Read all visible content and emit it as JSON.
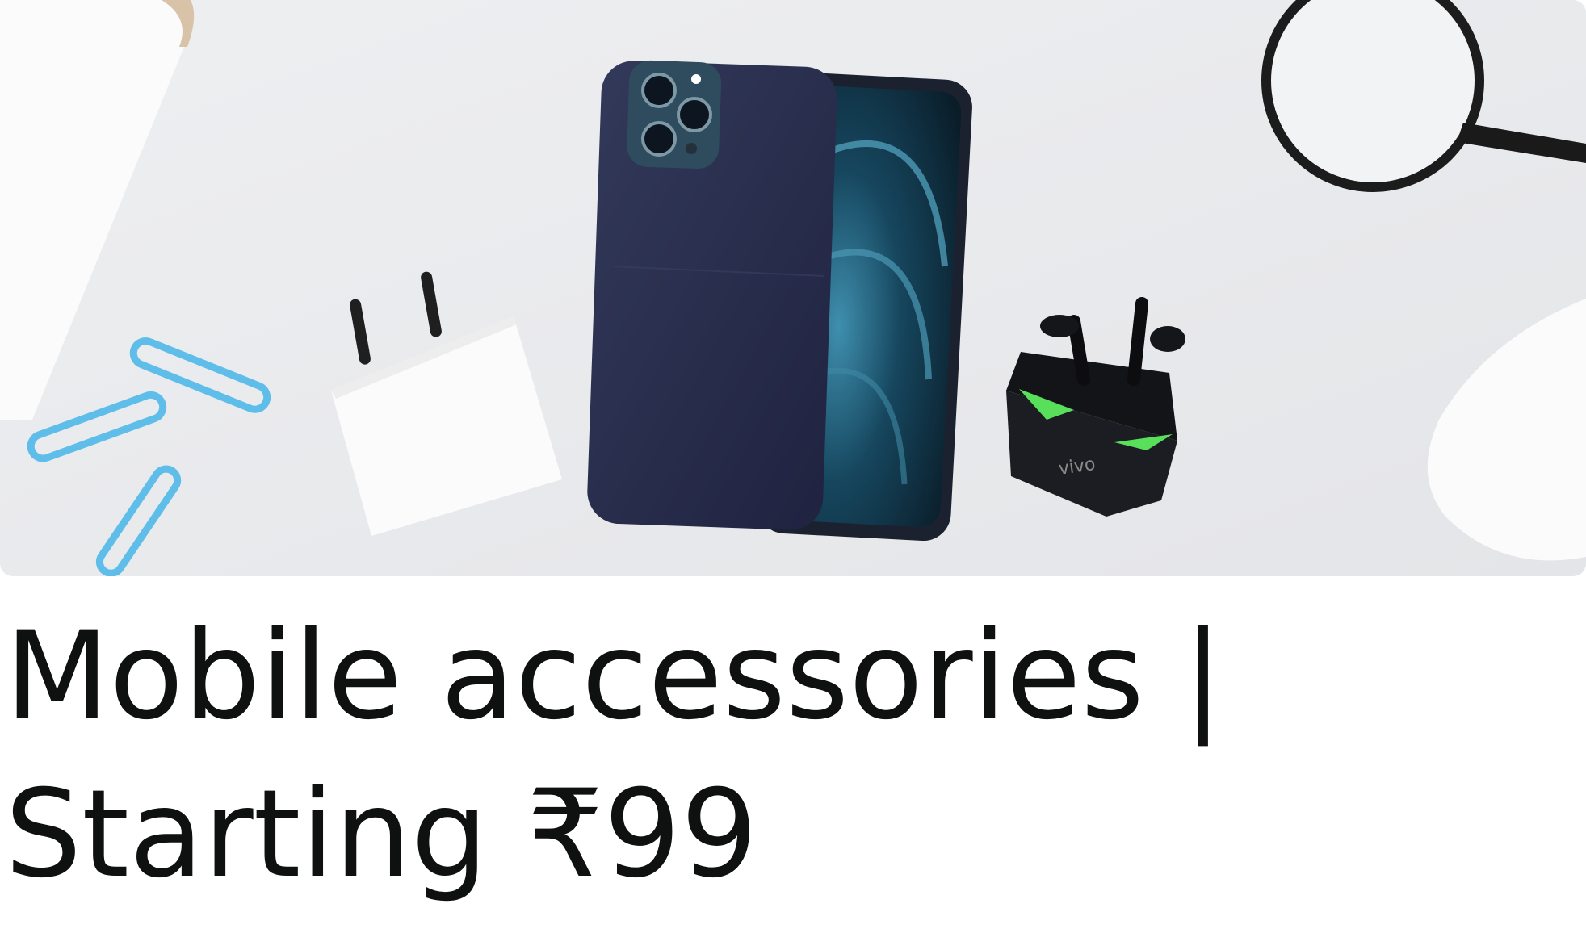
{
  "card": {
    "title_line1": "Mobile accessories |",
    "title_line2": "Starting ₹99"
  },
  "hero": {
    "items": [
      "phone-case",
      "smartphone",
      "charger",
      "earbuds",
      "paper-clips",
      "magnifying-glass"
    ],
    "earbuds_brand_mark": "vivo"
  },
  "colors": {
    "surface": "#e9eaec",
    "phone_case": "#2a2f4a",
    "screen": "#0e2f3f",
    "accent_green": "#5be05a",
    "clip_blue": "#66c3ee",
    "text": "#0f1111"
  }
}
